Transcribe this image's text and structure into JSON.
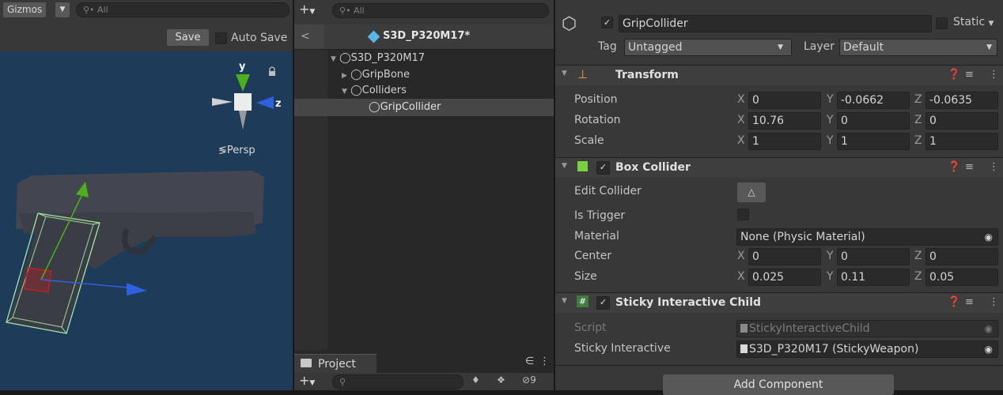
{
  "scene": {
    "gizmos_label": "Gizmos",
    "search_placeholder": "All",
    "save_label": "Save",
    "autosave_label": "Auto Save",
    "axis_y": "y",
    "axis_z": "z",
    "persp_label": "≶Persp"
  },
  "hierarchy": {
    "search_placeholder": "All",
    "prefab_title": "S3D_P320M17*",
    "items": [
      {
        "label": "S3D_P320M17"
      },
      {
        "label": "GripBone"
      },
      {
        "label": "Colliders"
      },
      {
        "label": "GripCollider"
      }
    ]
  },
  "project": {
    "tab_label": "Project",
    "badge_count": "9"
  },
  "inspector": {
    "object_name": "GripCollider",
    "static_label": "Static",
    "tag_label": "Tag",
    "tag_value": "Untagged",
    "layer_label": "Layer",
    "layer_value": "Default",
    "transform": {
      "title": "Transform",
      "position_label": "Position",
      "rotation_label": "Rotation",
      "scale_label": "Scale",
      "position": {
        "x": "0",
        "y": "-0.0662",
        "z": "-0.0635"
      },
      "rotation": {
        "x": "10.76",
        "y": "0",
        "z": "0"
      },
      "scale": {
        "x": "1",
        "y": "1",
        "z": "1"
      }
    },
    "box_collider": {
      "title": "Box Collider",
      "edit_label": "Edit Collider",
      "trigger_label": "Is Trigger",
      "material_label": "Material",
      "material_value": "None (Physic Material)",
      "center_label": "Center",
      "size_label": "Size",
      "center": {
        "x": "0",
        "y": "0",
        "z": "0"
      },
      "size": {
        "x": "0.025",
        "y": "0.11",
        "z": "0.05"
      }
    },
    "sticky": {
      "title": "Sticky Interactive Child",
      "script_label": "Script",
      "script_value": "StickyInteractiveChild",
      "sticky_label": "Sticky Interactive",
      "sticky_value": "S3D_P320M17 (StickyWeapon)"
    },
    "add_component_label": "Add Component",
    "axis_labels": {
      "x": "X",
      "y": "Y",
      "z": "Z"
    }
  },
  "colors": {
    "scene_bg": "#1e3b5a",
    "panel_bg": "#383838",
    "hierarchy_bg": "#282828",
    "field_bg": "#2a2a2a",
    "gizmo_green": "#4caf1c",
    "gizmo_blue": "#2e60e0",
    "gizmo_red": "#c02020"
  }
}
